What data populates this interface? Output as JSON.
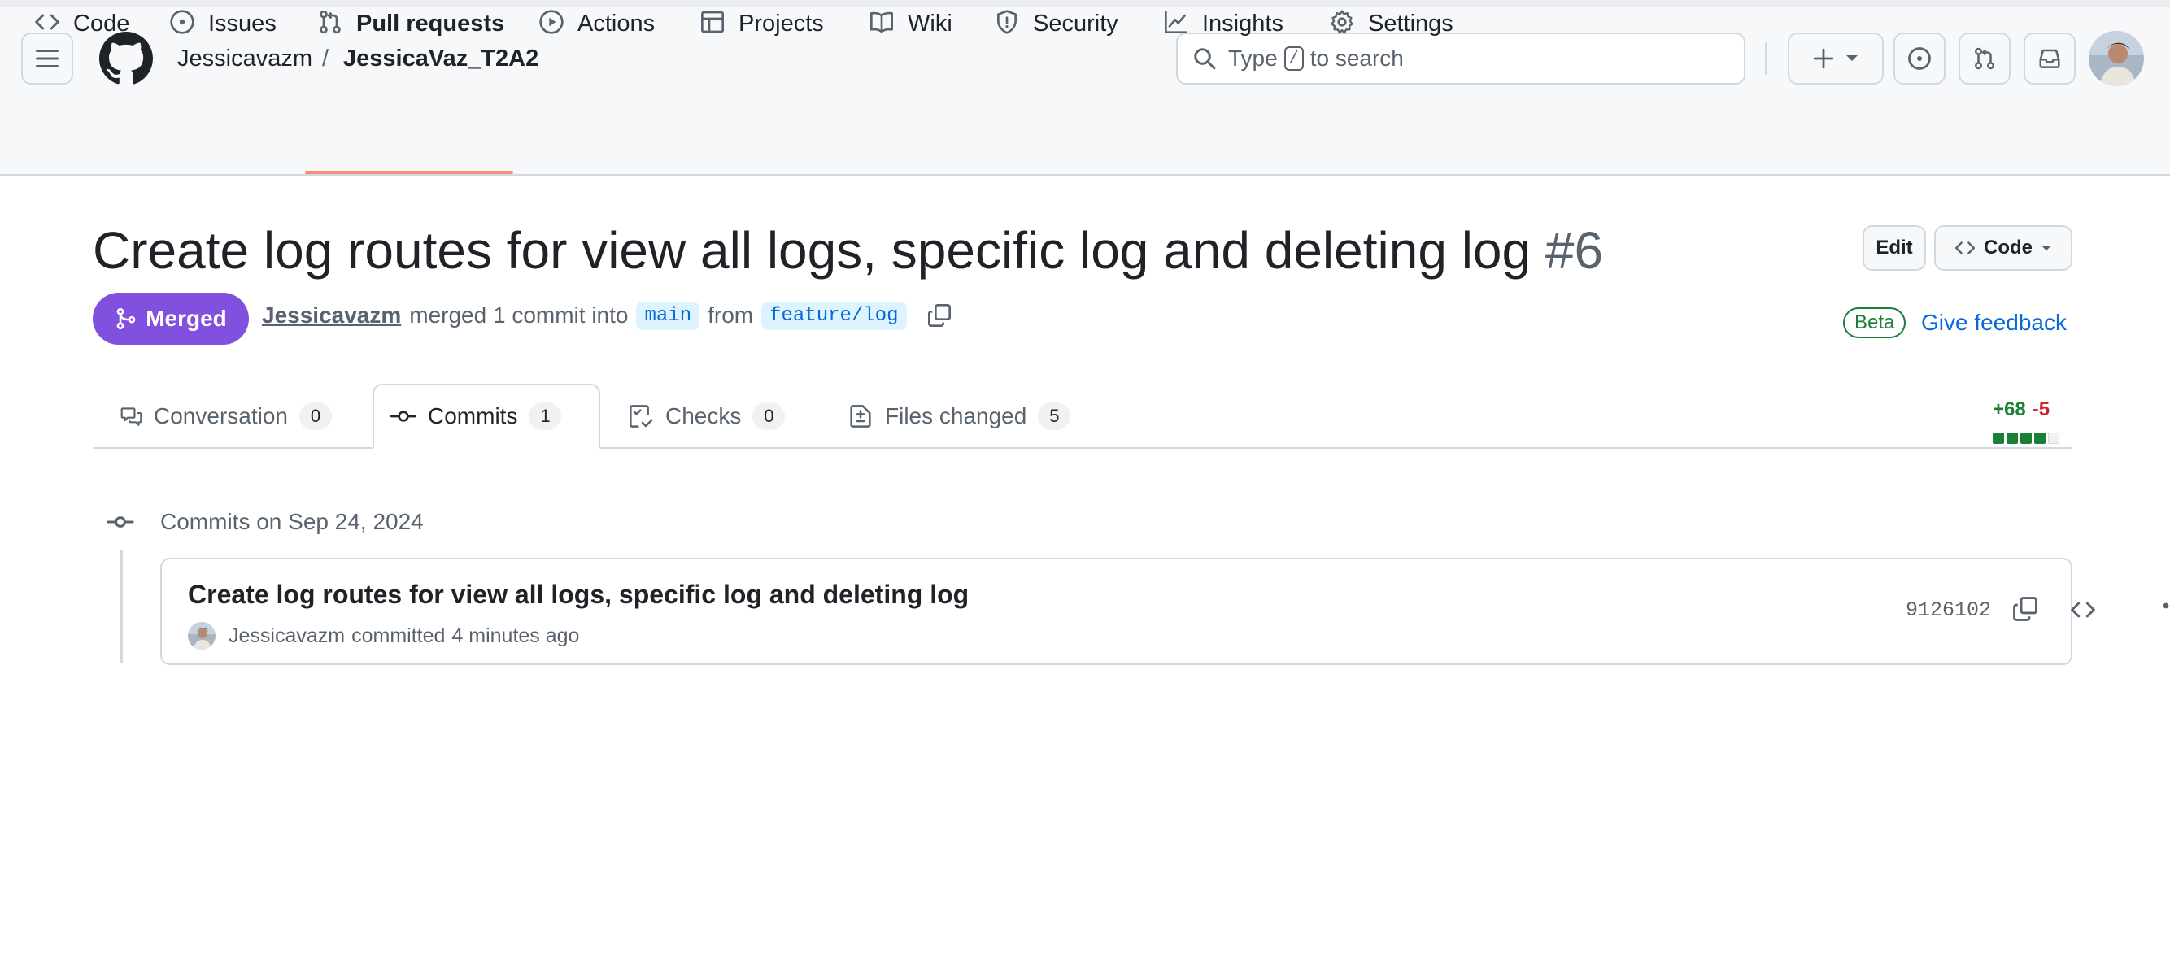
{
  "header": {
    "owner": "Jessicavazm",
    "separator": "/",
    "repo": "JessicaVaz_T2A2",
    "search": {
      "label_before": "Type",
      "shortcut": "/",
      "label_after": "to search"
    }
  },
  "repo_nav": {
    "items": [
      {
        "label": "Code",
        "icon": "code-icon"
      },
      {
        "label": "Issues",
        "icon": "issue-opened-icon"
      },
      {
        "label": "Pull requests",
        "icon": "git-pull-request-icon",
        "active": true
      },
      {
        "label": "Actions",
        "icon": "play-icon"
      },
      {
        "label": "Projects",
        "icon": "table-icon"
      },
      {
        "label": "Wiki",
        "icon": "book-icon"
      },
      {
        "label": "Security",
        "icon": "shield-icon"
      },
      {
        "label": "Insights",
        "icon": "graph-icon"
      },
      {
        "label": "Settings",
        "icon": "gear-icon"
      }
    ]
  },
  "pr": {
    "title": "Create log routes for view all logs, specific log and deleting log",
    "number": "#6",
    "edit_label": "Edit",
    "code_label": "Code",
    "state": "Merged",
    "author": "Jessicavazm",
    "merged_text": "merged 1 commit into",
    "base_branch": "main",
    "from_text": "from",
    "head_branch": "feature/log",
    "beta_label": "Beta",
    "feedback_label": "Give feedback"
  },
  "tabs": [
    {
      "label": "Conversation",
      "count": "0",
      "icon": "comment-discussion-icon"
    },
    {
      "label": "Commits",
      "count": "1",
      "icon": "git-commit-icon",
      "active": true
    },
    {
      "label": "Checks",
      "count": "0",
      "icon": "checklist-icon"
    },
    {
      "label": "Files changed",
      "count": "5",
      "icon": "file-diff-icon"
    }
  ],
  "diffstat": {
    "additions": "+68",
    "deletions": "-5",
    "blocks": [
      "added",
      "added",
      "added",
      "added",
      "neutral"
    ],
    "colors": {
      "added": "#1a7f37",
      "deleted": "#d1242f",
      "neutral": "#eff1f3"
    }
  },
  "commits": {
    "group_heading": "Commits on Sep 24, 2024",
    "items": [
      {
        "title": "Create log routes for view all logs, specific log and deleting log",
        "author": "Jessicavazm",
        "action": "committed",
        "time": "4 minutes ago",
        "sha": "9126102"
      }
    ]
  },
  "colors": {
    "accent_merged": "#8250df",
    "link": "#0969da",
    "nav_underline": "#fd8c73",
    "success": "#1a7f37",
    "danger": "#d1242f"
  }
}
